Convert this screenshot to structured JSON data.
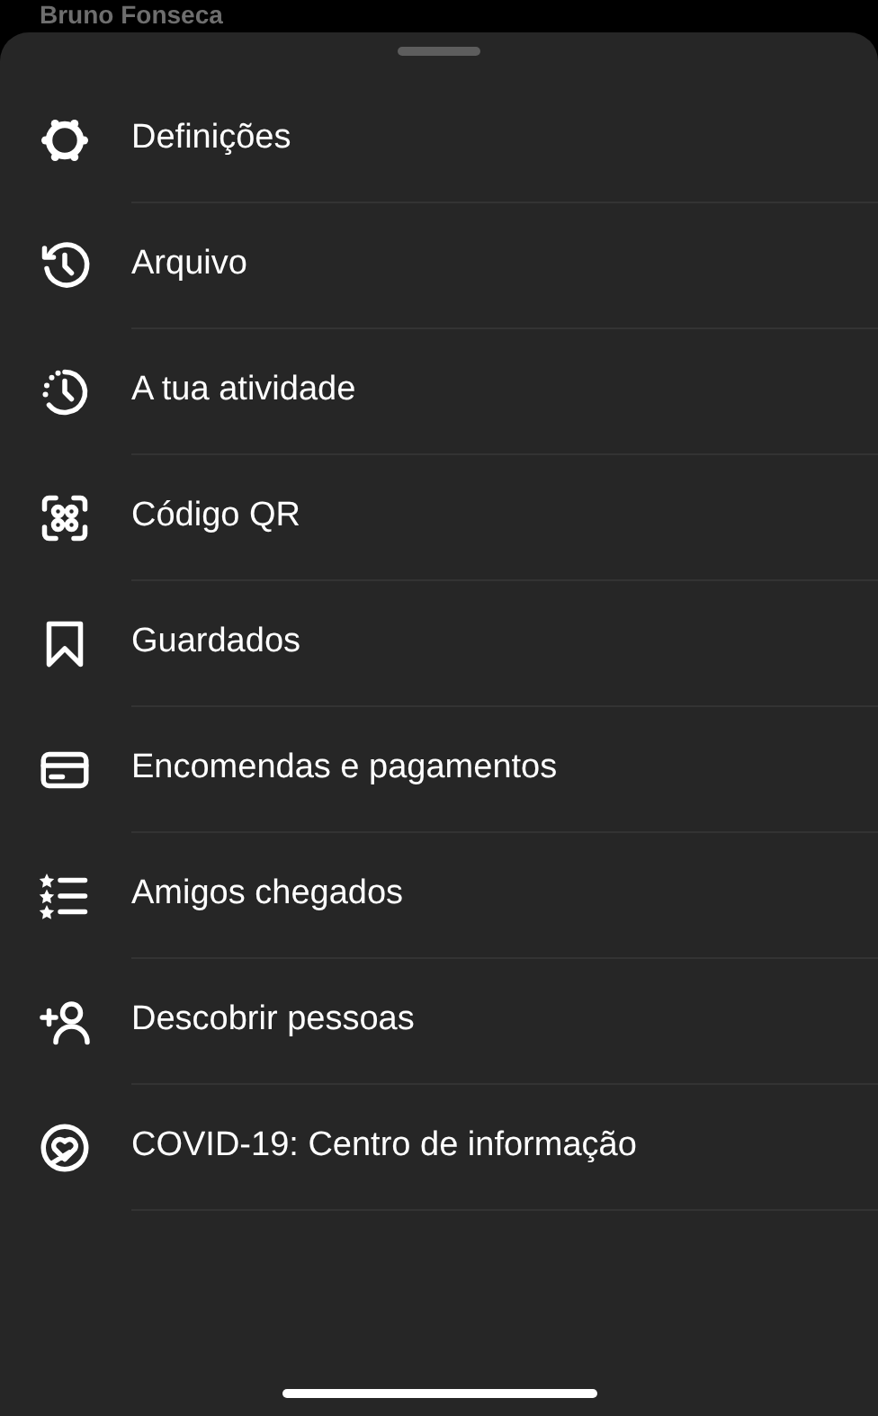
{
  "background_profile": {
    "name": "Bruno Fonseca"
  },
  "menu": [
    {
      "kind": "settings",
      "label": "Definições"
    },
    {
      "kind": "archive",
      "label": "Arquivo"
    },
    {
      "kind": "activity",
      "label": "A tua atividade"
    },
    {
      "kind": "qr",
      "label": "Código QR"
    },
    {
      "kind": "saved",
      "label": "Guardados"
    },
    {
      "kind": "payments",
      "label": "Encomendas e pagamentos"
    },
    {
      "kind": "close_friends",
      "label": "Amigos chegados"
    },
    {
      "kind": "discover",
      "label": "Descobrir pessoas"
    },
    {
      "kind": "covid",
      "label": "COVID-19: Centro de informação"
    }
  ]
}
